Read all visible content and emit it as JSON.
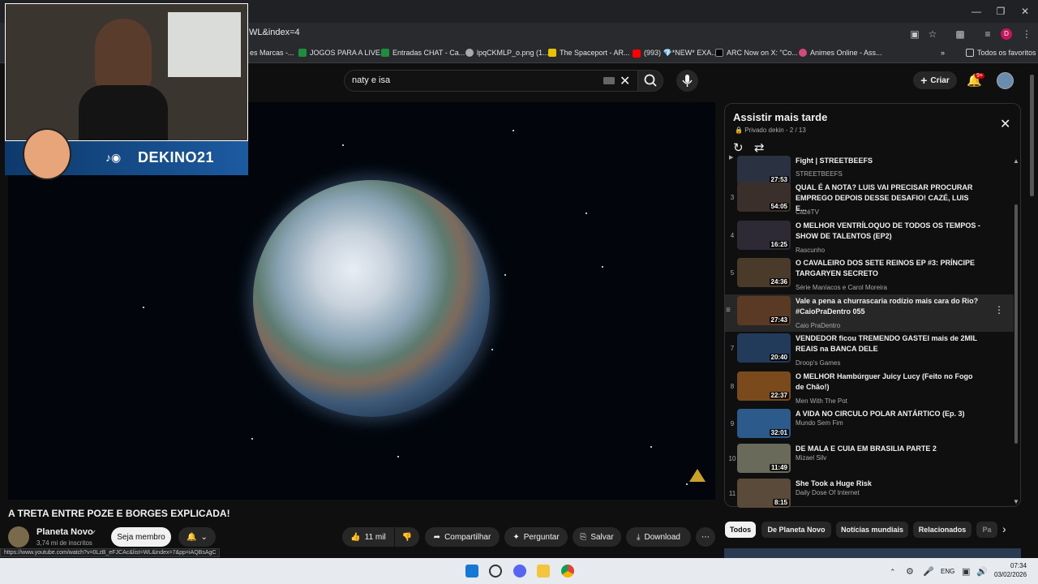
{
  "browser": {
    "url": "WL&index=4",
    "bookmarks": [
      "es Marcas -...",
      "JOGOS PARA A LIVE...",
      "Entradas CHAT - Ca...",
      "lpqCKMLP_o.png (1...",
      "The Spaceport - AR...",
      "(993) 💎*NEW* EXA...",
      "ARC Now on X: \"Co...",
      "Animes Online - Ass..."
    ],
    "all_bookmarks": "Todos os favoritos",
    "profile_initial": "D",
    "status_url": "https://www.youtube.com/watch?v=0LzB_eFJCAc&list=WL&index=7&pp=iAQBsAgC"
  },
  "youtube": {
    "search_value": "naty e isa",
    "create_label": "Criar",
    "notif_badge": "9+"
  },
  "stream": {
    "handle": "DEKINO21"
  },
  "video": {
    "title": "A TRETA ENTRE POZE E BORGES EXPLICADA!",
    "channel": "Planeta Novo",
    "subscribers": "3,74 mi de inscritos",
    "member_label": "Seja membro",
    "likes": "11 mil",
    "share_label": "Compartilhar",
    "ask_label": "Perguntar",
    "save_label": "Salvar",
    "download_label": "Download"
  },
  "playlist": {
    "title": "Assistir mais tarde",
    "meta": "Privado  dekin - 2 / 13",
    "items": [
      {
        "num": "",
        "title": "Fight | STREETBEEFS",
        "channel": "STREETBEEFS",
        "duration": "27:53"
      },
      {
        "num": "3",
        "title": "QUAL É A NOTA? LUIS VAI PRECISAR PROCURAR EMPREGO DEPOIS DESSE DESAFIO! CAZÉ, LUIS E...",
        "channel": "CazéTV",
        "duration": "54:05"
      },
      {
        "num": "4",
        "title": "O MELHOR VENTRÍLOQUO DE TODOS OS TEMPOS - SHOW DE TALENTOS (EP2)",
        "channel": "Rascunho",
        "duration": "16:25"
      },
      {
        "num": "5",
        "title": "O CAVALEIRO DOS SETE REINOS EP #3: PRÍNCIPE TARGARYEN SECRETO",
        "channel": "Série Maníacos e Carol Moreira",
        "duration": "24:36"
      },
      {
        "num": "",
        "title": "Vale a pena a churrascaria rodízio mais cara do Rio? #CaioPraDentro 055",
        "channel": "Caio PraDentro",
        "duration": "27:43"
      },
      {
        "num": "7",
        "title": "VENDEDOR ficou TREMENDO GASTEI mais de 2MIL REAIS na BANCA DELE",
        "channel": "Droop's Games",
        "duration": "20:40"
      },
      {
        "num": "8",
        "title": "O MELHOR Hambúrguer Juicy Lucy (Feito no Fogo de Chão!)",
        "channel": "Men With The Pot",
        "duration": "22:37"
      },
      {
        "num": "9",
        "title": "A VIDA NO CIRCULO POLAR ANTÁRTICO (Ep. 3)",
        "channel": "Mundo Sem Fim",
        "duration": "32:01"
      },
      {
        "num": "10",
        "title": "DE MALA E CUIA EM BRASILIA PARTE 2",
        "channel": "Mizael Silv",
        "duration": "11:49"
      },
      {
        "num": "11",
        "title": "She Took a Huge Risk",
        "channel": "Daily Dose Of Internet",
        "duration": "8:15"
      }
    ]
  },
  "chips": [
    "Todos",
    "De Planeta Novo",
    "Notícias mundiais",
    "Relacionados",
    "Pa"
  ],
  "taskbar": {
    "lang": "ENG",
    "time": "07:34",
    "date": "03/02/2026"
  }
}
